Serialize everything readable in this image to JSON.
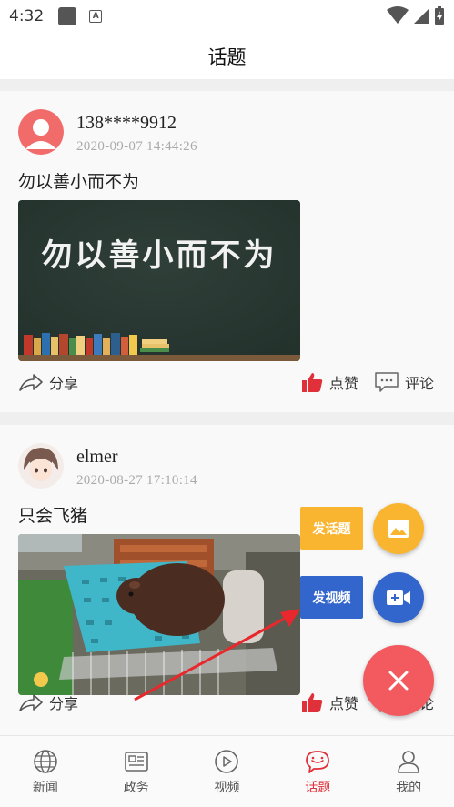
{
  "status_bar": {
    "time": "4:32"
  },
  "header": {
    "title": "话题"
  },
  "posts": [
    {
      "user": "138****9912",
      "time": "2020-09-07  14:44:26",
      "text": "勿以善小而不为",
      "image_text": "勿以善小而不为",
      "share": "分享",
      "like": "点赞",
      "comment": "评论"
    },
    {
      "user": "elmer",
      "time": "2020-08-27  17:10:14",
      "text": "只会飞猪",
      "share": "分享",
      "like": "点赞",
      "comment": "评论"
    }
  ],
  "fab_menu": {
    "topic_label": "发话题",
    "video_label": "发视频"
  },
  "bottom_nav": [
    {
      "label": "新闻",
      "icon": "globe-icon"
    },
    {
      "label": "政务",
      "icon": "newspaper-icon"
    },
    {
      "label": "视频",
      "icon": "play-circle-icon"
    },
    {
      "label": "话题",
      "icon": "chat-bubble-icon",
      "active": true
    },
    {
      "label": "我的",
      "icon": "person-icon"
    }
  ],
  "colors": {
    "accent_red": "#e0303a",
    "fab_yellow": "#f9b530",
    "fab_blue": "#3366cc",
    "fab_close": "#f25a5f"
  }
}
